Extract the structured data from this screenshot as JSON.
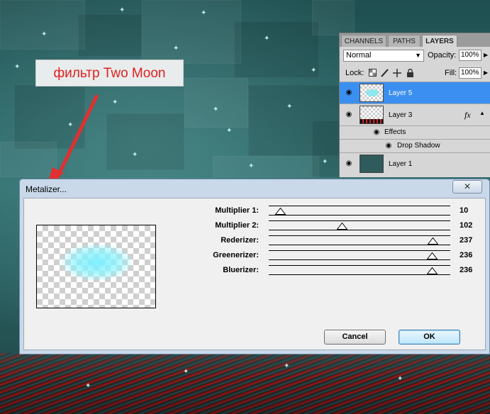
{
  "annotation": {
    "text": "фильтр Two Moon",
    "color": "#e02020"
  },
  "layers_panel": {
    "tabs": [
      "CHANNELS",
      "PATHS",
      "LAYERS"
    ],
    "active_tab": "LAYERS",
    "blend_mode": "Normal",
    "opacity_label": "Opacity:",
    "opacity_value": "100%",
    "lock_label": "Lock:",
    "fill_label": "Fill:",
    "fill_value": "100%",
    "fx_label": "fx",
    "layers": [
      {
        "name": "Layer 5",
        "selected": true
      },
      {
        "name": "Layer 3",
        "selected": false
      },
      {
        "name": "Effects",
        "selected": false
      },
      {
        "name": "Drop Shadow",
        "selected": false
      },
      {
        "name": "Layer 1",
        "selected": false
      }
    ],
    "selection_color": "#3b8ff0"
  },
  "dialog": {
    "title": "Metalizer...",
    "close_glyph": "✕",
    "sliders": [
      {
        "label": "Multiplier 1:",
        "value": "10",
        "level": 10
      },
      {
        "label": "Multiplier 2:",
        "value": "102",
        "level": 102
      },
      {
        "label": "Rederizer:",
        "value": "237",
        "level": 237
      },
      {
        "label": "Greenerizer:",
        "value": "236",
        "level": 236
      },
      {
        "label": "Bluerizer:",
        "value": "236",
        "level": 236
      }
    ],
    "slider_max": 255,
    "cancel_label": "Cancel",
    "ok_label": "OK"
  },
  "icons": {
    "eye": "eye-icon",
    "lock_transparent": "checker-lock-icon",
    "lock_brush": "brush-lock-icon",
    "lock_move": "move-lock-icon",
    "lock_all": "padlock-icon",
    "close": "close-icon"
  }
}
